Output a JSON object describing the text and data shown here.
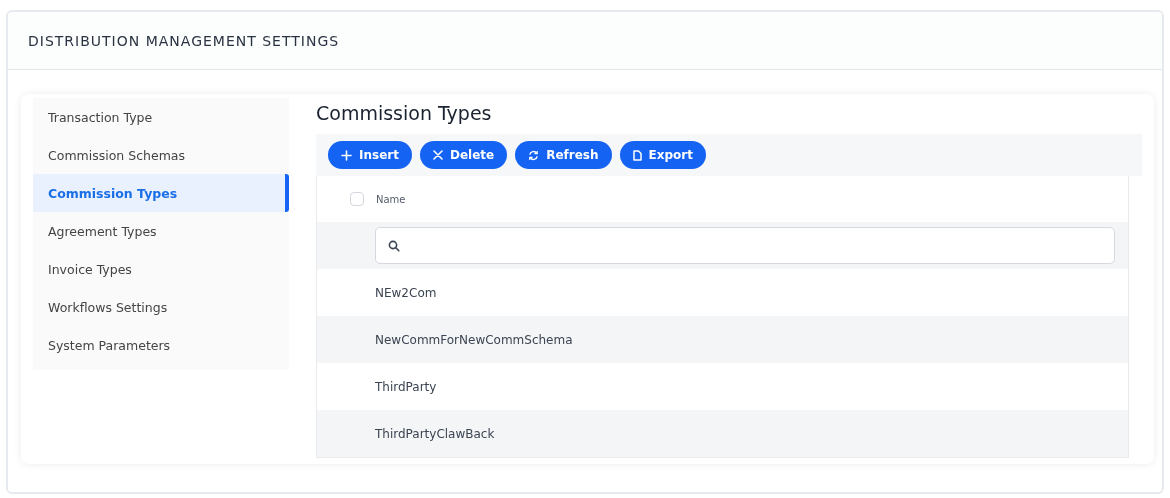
{
  "header": {
    "title": "DISTRIBUTION MANAGEMENT SETTINGS"
  },
  "sidebar": {
    "items": [
      {
        "label": "Transaction Type",
        "selected": false
      },
      {
        "label": "Commission Schemas",
        "selected": false
      },
      {
        "label": "Commission Types",
        "selected": true
      },
      {
        "label": "Agreement Types",
        "selected": false
      },
      {
        "label": "Invoice Types",
        "selected": false
      },
      {
        "label": "Workflows Settings",
        "selected": false
      },
      {
        "label": "System Parameters",
        "selected": false
      }
    ]
  },
  "content": {
    "title": "Commission Types",
    "toolbar": [
      {
        "label": "Insert",
        "kind": "insert"
      },
      {
        "label": "Delete",
        "kind": "delete"
      },
      {
        "label": "Refresh",
        "kind": "refresh"
      },
      {
        "label": "Export",
        "kind": "export"
      }
    ],
    "table": {
      "select_all": {
        "checked": false
      },
      "columns": [
        "Name"
      ],
      "rows": [
        [
          "NEw2Com"
        ],
        [
          "NewCommForNewCommSchema"
        ],
        [
          "ThirdParty"
        ],
        [
          "ThirdPartyClawBack"
        ]
      ]
    }
  }
}
